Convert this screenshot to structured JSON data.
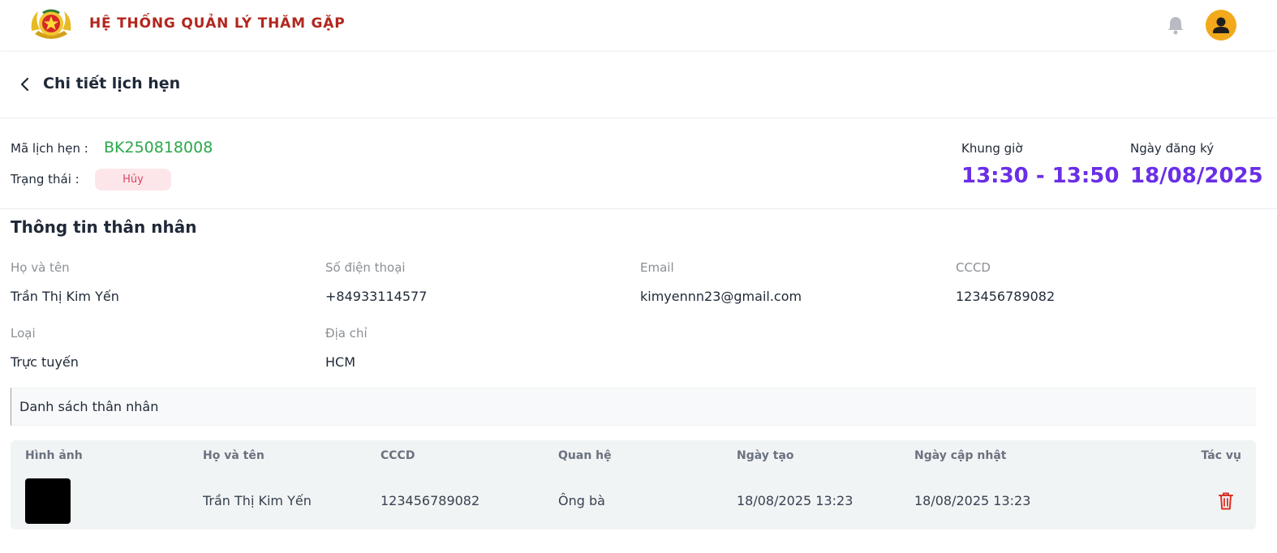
{
  "header": {
    "app_title": "HỆ THỐNG QUẢN LÝ THĂM GẶP",
    "logo_icon": "police-emblem-icon",
    "notification_icon": "bell-icon",
    "user_icon": "user-avatar-icon"
  },
  "page": {
    "title": "Chi tiết lịch hẹn",
    "back_icon": "chevron-left-icon"
  },
  "appointment": {
    "code_label": "Mã lịch hẹn :",
    "code": "BK250818008",
    "status_label": "Trạng thái :",
    "status": "Hủy",
    "time_slot_label": "Khung giờ",
    "time_slot": "13:30 - 13:50",
    "register_date_label": "Ngày đăng ký",
    "register_date": "18/08/2025"
  },
  "relative_info": {
    "title": "Thông tin thân nhân",
    "name_label": "Họ và tên",
    "name": "Trần Thị Kim Yến",
    "phone_label": "Số điện thoại",
    "phone": "+84933114577",
    "email_label": "Email",
    "email": "kimyennn23@gmail.com",
    "id_label": "CCCD",
    "id": "123456789082",
    "type_label": "Loại",
    "type": "Trực tuyến",
    "address_label": "Địa chỉ",
    "address": "HCM"
  },
  "relatives_list": {
    "title": "Danh sách thân nhân",
    "columns": [
      "Hình ảnh",
      "Họ và tên",
      "CCCD",
      "Quan hệ",
      "Ngày tạo",
      "Ngày cập nhật",
      "Tác vụ"
    ],
    "rows": [
      {
        "name": "Trần Thị Kim Yến",
        "id": "123456789082",
        "relation": "Ông bà",
        "created": "18/08/2025 13:23",
        "updated": "18/08/2025 13:23",
        "action_icon": "trash-icon"
      }
    ]
  },
  "colors": {
    "brand_title": "#b3261e",
    "code": "#2aa84a",
    "highlight": "#6a2ee6",
    "status_bg": "#fde6ea",
    "status_text": "#d9455f",
    "avatar": "#f2a91c",
    "delete": "#d93025"
  }
}
